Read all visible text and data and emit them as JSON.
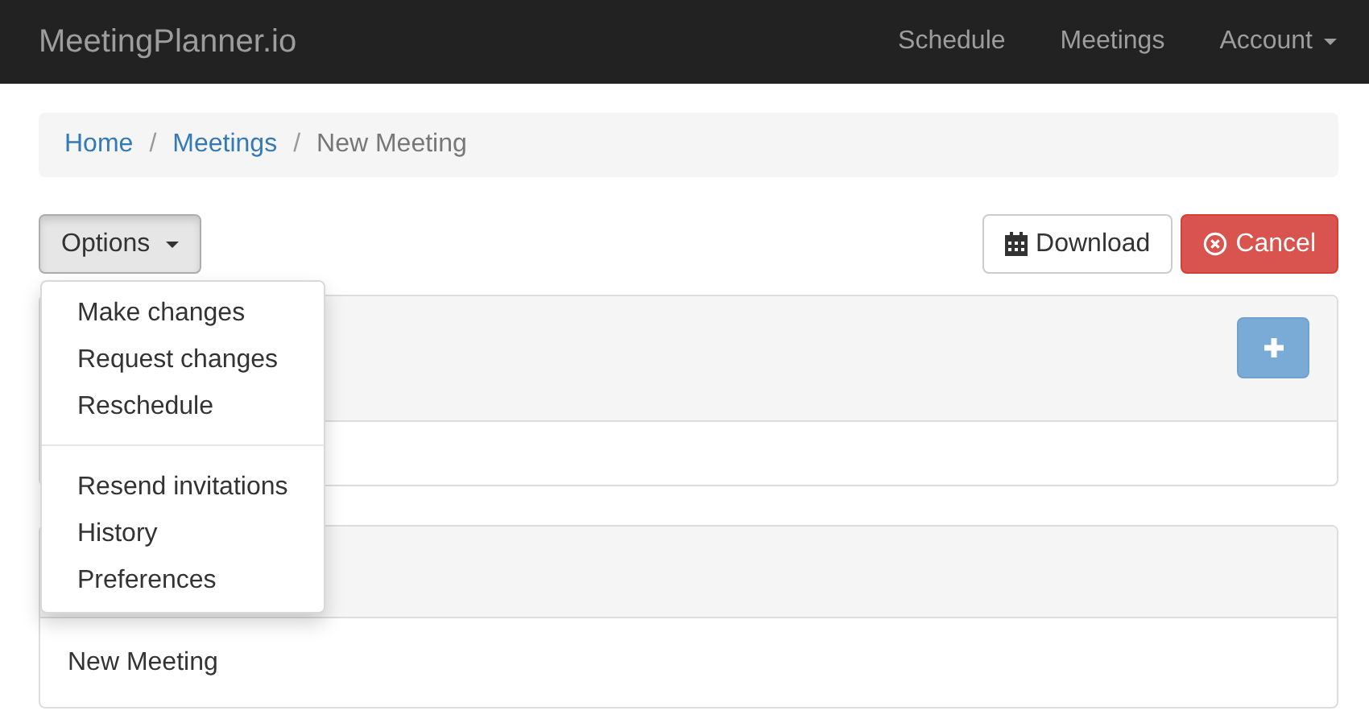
{
  "navbar": {
    "brand": "MeetingPlanner.io",
    "links": [
      {
        "label": "Schedule",
        "dropdown": false
      },
      {
        "label": "Meetings",
        "dropdown": false
      },
      {
        "label": "Account",
        "dropdown": true
      }
    ]
  },
  "breadcrumb": {
    "links": [
      "Home",
      "Meetings"
    ],
    "separators": [
      "/",
      "/"
    ],
    "current": "New Meeting"
  },
  "options_menu": {
    "label": "Options",
    "expanded": true,
    "groups": [
      {
        "items": [
          "Make changes",
          "Request changes",
          "Reschedule"
        ]
      },
      {
        "items": [
          "Resend invitations",
          "History",
          "Preferences"
        ]
      }
    ]
  },
  "actions": [
    {
      "label": "Download",
      "kind": "default"
    },
    {
      "label": "Cancel",
      "kind": "danger"
    }
  ],
  "panels": [
    {
      "has_add_button": true
    },
    {
      "has_add_button": false,
      "body": "New Meeting"
    }
  ]
}
